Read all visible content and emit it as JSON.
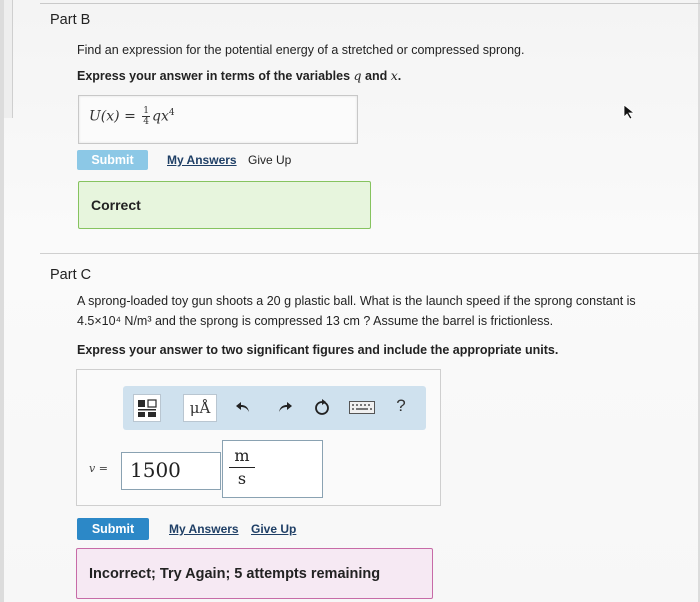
{
  "partB": {
    "title": "Part B",
    "prompt": "Find an expression for the potential energy of a stretched or compressed sprong.",
    "instruction_prefix": "Express your answer in terms of the variables ",
    "var1": "q",
    "and": " and ",
    "var2": "x",
    "period": ".",
    "answer": {
      "lhs": "U(x) = ",
      "frac_num": "1",
      "frac_den": "4",
      "rhs_base": "qx",
      "rhs_exp": "4"
    },
    "submit_label": "Submit",
    "my_answers_label": "My Answers",
    "give_up_label": "Give Up",
    "feedback": "Correct"
  },
  "partC": {
    "title": "Part C",
    "prompt_line1": "A sprong-loaded toy gun shoots a 20 g plastic ball. What is the launch speed if the sprong constant is",
    "prompt_line2": "4.5×10⁴ N/m³ and the sprong is compressed 13 cm ? Assume the barrel is frictionless.",
    "instruction": "Express your answer to two significant figures and include the appropriate units.",
    "toolbar": {
      "template_label": "templates",
      "units_label": "μÅ",
      "help_label": "?"
    },
    "var_label": "v =",
    "value": "1500",
    "unit_num": "m",
    "unit_den": "s",
    "submit_label": "Submit",
    "my_answers_label": "My Answers",
    "give_up_label": "Give Up",
    "feedback": "Incorrect; Try Again; 5 attempts remaining"
  },
  "colors": {
    "submit_inactive": "#8cc8e6",
    "submit_active": "#2c88c7",
    "correct_bg": "#e7f5dd",
    "correct_border": "#86c35f",
    "incorrect_bg": "#f6e9f3",
    "incorrect_border": "#c76ba7",
    "toolbar_bg": "#cfe1ee"
  }
}
